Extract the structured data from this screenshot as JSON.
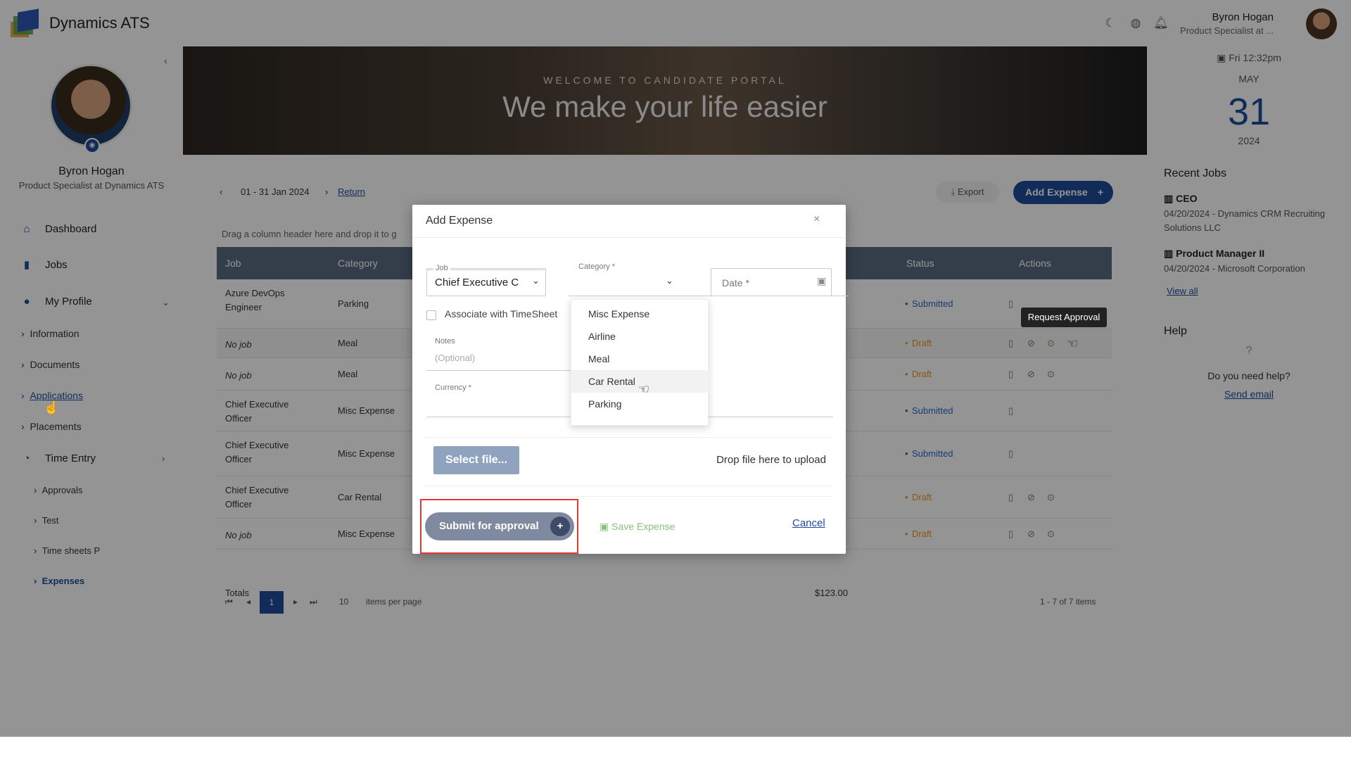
{
  "app": {
    "title": "Dynamics ATS"
  },
  "topbar": {
    "icons": [
      "moon-icon",
      "globe-icon",
      "bell-icon"
    ],
    "user_name": "Byron Hogan",
    "user_role": "Product Specialist at ..."
  },
  "sidebar": {
    "name": "Byron Hogan",
    "role": "Product Specialist at Dynamics ATS",
    "items": [
      {
        "label": "Dashboard",
        "icon": "home-icon"
      },
      {
        "label": "Jobs",
        "icon": "briefcase-icon"
      },
      {
        "label": "My Profile",
        "icon": "user-icon"
      },
      {
        "label": "Information"
      },
      {
        "label": "Documents"
      },
      {
        "label": "Applications"
      },
      {
        "label": "Placements"
      },
      {
        "label": "Time Entry",
        "icon": "clock-icon"
      },
      {
        "label": "Approvals"
      },
      {
        "label": "Test"
      },
      {
        "label": "Time sheets P"
      },
      {
        "label": "Expenses"
      }
    ]
  },
  "banner": {
    "subtitle": "WELCOME TO CANDIDATE PORTAL",
    "title": "We make your life easier"
  },
  "right_panel": {
    "day": "Fri 12:32pm",
    "month": "MAY",
    "date": "31",
    "year": "2024",
    "recent_jobs_title": "Recent Jobs",
    "jobs": [
      {
        "title": "CEO",
        "sub": "04/20/2024 - Dynamics CRM Recruiting Solutions LLC"
      },
      {
        "title": "Product Manager II",
        "sub": "04/20/2024 - Microsoft Corporation"
      }
    ],
    "view_all": "View all",
    "help_title": "Help",
    "help_q": "?",
    "help_text": "Do you need help?",
    "help_link": "Send email"
  },
  "expenses": {
    "range": "01 - 31 Jan 2024",
    "return": "Return",
    "export": "Export",
    "add": "Add Expense",
    "drag_hint": "Drag a column header here and drop it to g",
    "columns": [
      "Job",
      "Category",
      "Status",
      "Actions"
    ],
    "rows": [
      {
        "job": "Azure DevOps Engineer",
        "category": "Parking",
        "status": "Submitted"
      },
      {
        "job": "No job",
        "category": "Meal",
        "status": "Draft"
      },
      {
        "job": "No job",
        "category": "Meal",
        "status": "Draft"
      },
      {
        "job": "Chief Executive Officer",
        "category": "Misc Expense",
        "status": "Submitted"
      },
      {
        "job": "Chief Executive Officer",
        "category": "Misc Expense",
        "status": "Submitted"
      },
      {
        "job": "Chief Executive Officer",
        "category": "Car Rental",
        "status": "Draft"
      },
      {
        "job": "No job",
        "category": "Misc Expense",
        "status": "Draft"
      }
    ],
    "totals_label": "Totals",
    "totals_value": "$123.00",
    "page": "1",
    "page_size": "10",
    "per_page_label": "items per page",
    "range_label": "1 - 7 of 7 items",
    "tooltip": "Request Approval"
  },
  "modal": {
    "title": "Add Expense",
    "job_label": "Job",
    "job_value": "Chief Executive C",
    "category_label": "Category *",
    "date_label": "Date *",
    "associate_label": "Associate with TimeSheet",
    "notes_label": "Notes",
    "notes_placeholder": "(Optional)",
    "currency_label": "Currency *",
    "category_options": [
      "Misc Expense",
      "Airline",
      "Meal",
      "Car Rental",
      "Parking"
    ],
    "select_file": "Select file...",
    "drop_text": "Drop file here to upload",
    "submit": "Submit for approval",
    "save": "Save Expense",
    "cancel": "Cancel"
  }
}
